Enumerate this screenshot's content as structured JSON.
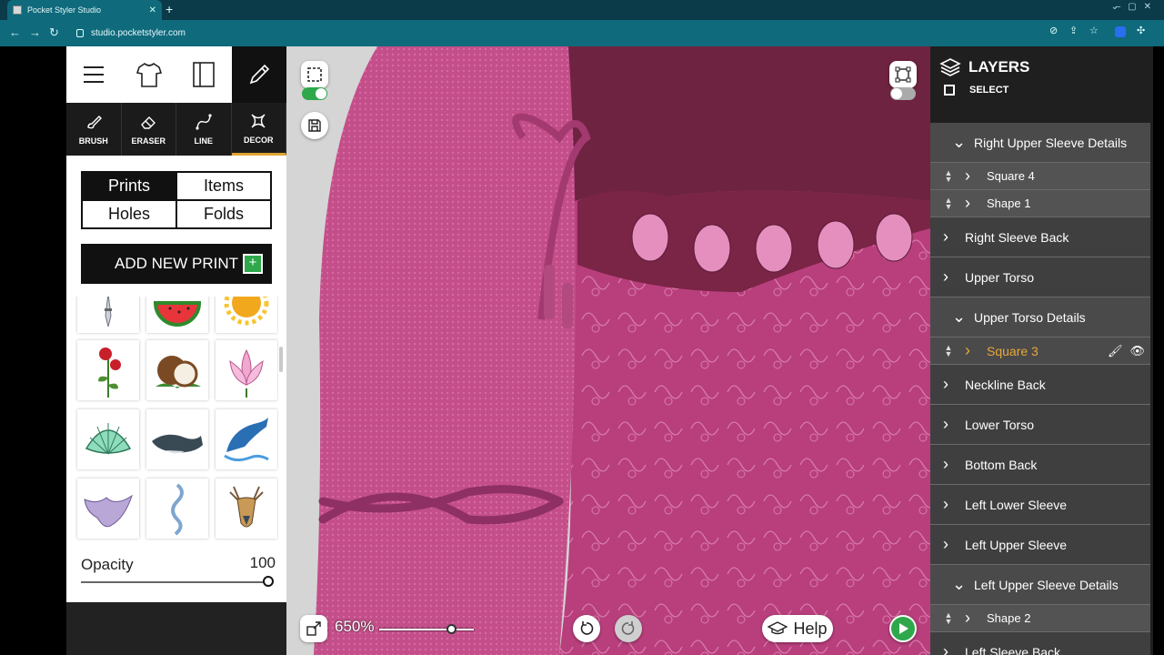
{
  "browser": {
    "tab_title": "Pocket Styler Studio",
    "new_tab_symbol": "+",
    "url": "studio.pocketstyler.com"
  },
  "toolbar": {
    "tools": [
      {
        "label": "BRUSH"
      },
      {
        "label": "ERASER"
      },
      {
        "label": "LINE"
      },
      {
        "label": "DECOR"
      }
    ],
    "active_tool": "DECOR"
  },
  "decor": {
    "tabs": [
      "Prints",
      "Items",
      "Holes",
      "Folds"
    ],
    "active_tab": "Prints",
    "add_new_print_label": "ADD NEW PRINT",
    "prints": [
      "dagger",
      "watermelon",
      "sun",
      "rose",
      "coconut",
      "lotus",
      "shell",
      "whale",
      "dolphin",
      "bat",
      "snake",
      "deer"
    ]
  },
  "opacity": {
    "label": "Opacity",
    "value": "100",
    "level": 1.0
  },
  "canvas": {
    "zoom_label": "650%",
    "zoom_level": 0.72,
    "help_label": "Help",
    "colors": {
      "accent_green": "#2ea84b",
      "dress_pink": "#c24b86",
      "background_maroon": "#6e2340"
    }
  },
  "layers": {
    "title": "LAYERS",
    "select_label": "SELECT",
    "rows": [
      {
        "label": "Right Upper Sleeve Details",
        "kind": "hdr"
      },
      {
        "label": "Square 4",
        "kind": "sub"
      },
      {
        "label": "Shape 1",
        "kind": "sub"
      },
      {
        "label": "Right Sleeve Back",
        "kind": "row"
      },
      {
        "label": "Upper Torso",
        "kind": "row"
      },
      {
        "label": "Upper Torso Details",
        "kind": "hdr"
      },
      {
        "label": "Square 3",
        "kind": "sel"
      },
      {
        "label": "Neckline Back",
        "kind": "row"
      },
      {
        "label": "Lower Torso",
        "kind": "row"
      },
      {
        "label": "Bottom Back",
        "kind": "row"
      },
      {
        "label": "Left Lower Sleeve",
        "kind": "row"
      },
      {
        "label": "Left Upper Sleeve",
        "kind": "row"
      },
      {
        "label": "Left Upper Sleeve Details",
        "kind": "hdr"
      },
      {
        "label": "Shape 2",
        "kind": "sub"
      },
      {
        "label": "Left Sleeve Back",
        "kind": "row"
      }
    ]
  }
}
